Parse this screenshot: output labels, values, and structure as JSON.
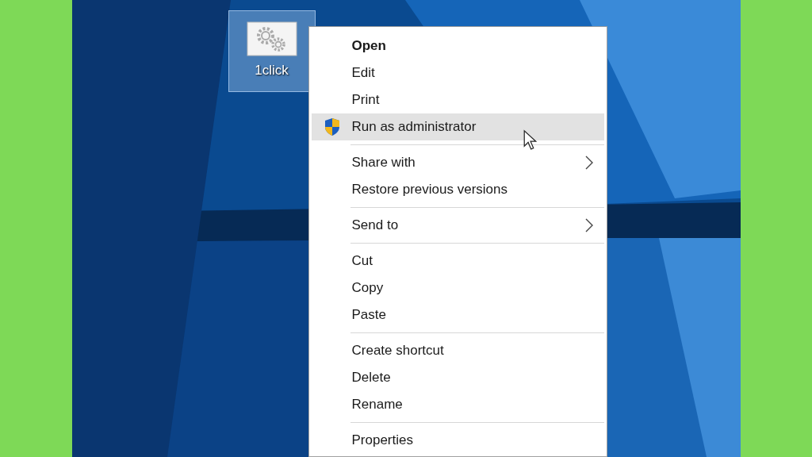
{
  "desktop_icon": {
    "label": "1click",
    "selected": true
  },
  "context_menu": {
    "groups": [
      {
        "items": [
          {
            "label": "Open",
            "kind": "plain",
            "default": true,
            "selected": false
          },
          {
            "label": "Edit",
            "kind": "plain",
            "default": false,
            "selected": false
          },
          {
            "label": "Print",
            "kind": "plain",
            "default": false,
            "selected": false
          },
          {
            "label": "Run as administrator",
            "kind": "shield",
            "default": false,
            "selected": true
          }
        ]
      },
      {
        "items": [
          {
            "label": "Share with",
            "kind": "submenu",
            "default": false,
            "selected": false
          },
          {
            "label": "Restore previous versions",
            "kind": "plain",
            "default": false,
            "selected": false
          }
        ]
      },
      {
        "items": [
          {
            "label": "Send to",
            "kind": "submenu",
            "default": false,
            "selected": false
          }
        ]
      },
      {
        "items": [
          {
            "label": "Cut",
            "kind": "plain",
            "default": false,
            "selected": false
          },
          {
            "label": "Copy",
            "kind": "plain",
            "default": false,
            "selected": false
          },
          {
            "label": "Paste",
            "kind": "plain",
            "default": false,
            "selected": false
          }
        ]
      },
      {
        "items": [
          {
            "label": "Create shortcut",
            "kind": "plain",
            "default": false,
            "selected": false
          },
          {
            "label": "Delete",
            "kind": "plain",
            "default": false,
            "selected": false
          },
          {
            "label": "Rename",
            "kind": "plain",
            "default": false,
            "selected": false
          }
        ]
      },
      {
        "items": [
          {
            "label": "Properties",
            "kind": "plain",
            "default": false,
            "selected": false
          }
        ]
      }
    ]
  }
}
